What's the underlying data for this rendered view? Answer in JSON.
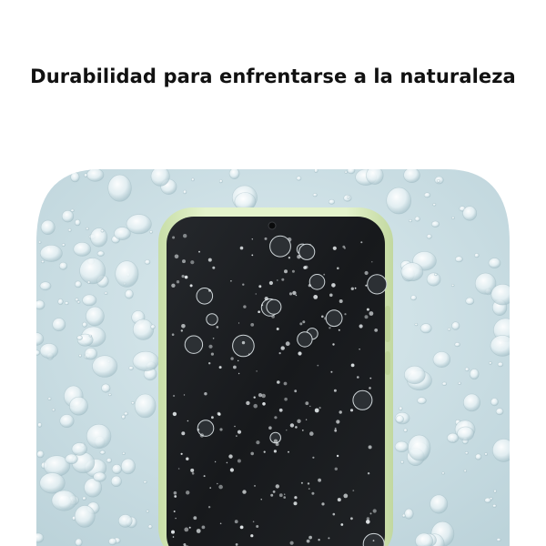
{
  "headline": "Durabilidad para enfrentarse a la naturaleza",
  "image": {
    "subject": "smartphone-with-water-droplets",
    "colors": {
      "surface": "#c9dde3",
      "surface_light": "#dcebef",
      "phone_frame": "#d6eab8",
      "screen": "#1b1d20",
      "droplet": "#ffffff"
    }
  }
}
